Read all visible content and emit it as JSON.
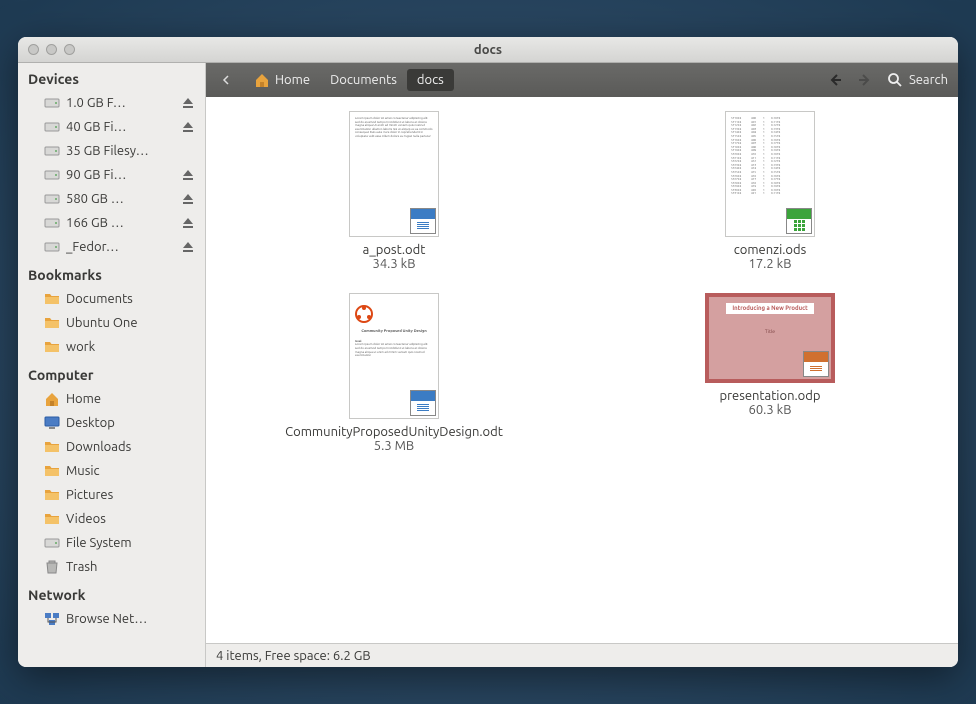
{
  "window": {
    "title": "docs"
  },
  "toolbar": {
    "crumbs": [
      "Home",
      "Documents",
      "docs"
    ],
    "search_label": "Search"
  },
  "sidebar": {
    "sections": [
      {
        "header": "Devices",
        "items": [
          {
            "label": "1.0 GB F…",
            "icon": "drive",
            "eject": true
          },
          {
            "label": "40 GB Fi…",
            "icon": "drive",
            "eject": true
          },
          {
            "label": "35 GB Filesy…",
            "icon": "drive",
            "eject": false
          },
          {
            "label": "90 GB Fi…",
            "icon": "drive",
            "eject": true
          },
          {
            "label": "580 GB …",
            "icon": "drive",
            "eject": true
          },
          {
            "label": "166 GB …",
            "icon": "drive",
            "eject": true
          },
          {
            "label": "_Fedor…",
            "icon": "drive",
            "eject": true
          }
        ]
      },
      {
        "header": "Bookmarks",
        "items": [
          {
            "label": "Documents",
            "icon": "folder",
            "eject": false
          },
          {
            "label": "Ubuntu One",
            "icon": "folder",
            "eject": false
          },
          {
            "label": "work",
            "icon": "folder",
            "eject": false
          }
        ]
      },
      {
        "header": "Computer",
        "items": [
          {
            "label": "Home",
            "icon": "home",
            "eject": false
          },
          {
            "label": "Desktop",
            "icon": "desktop",
            "eject": false
          },
          {
            "label": "Downloads",
            "icon": "folder",
            "eject": false
          },
          {
            "label": "Music",
            "icon": "folder",
            "eject": false
          },
          {
            "label": "Pictures",
            "icon": "folder",
            "eject": false
          },
          {
            "label": "Videos",
            "icon": "folder",
            "eject": false
          },
          {
            "label": "File System",
            "icon": "drive",
            "eject": false
          },
          {
            "label": "Trash",
            "icon": "trash",
            "eject": false
          }
        ]
      },
      {
        "header": "Network",
        "items": [
          {
            "label": "Browse Net…",
            "icon": "network",
            "eject": false
          }
        ]
      }
    ]
  },
  "files": [
    {
      "name": "a_post.odt",
      "size": "34.3 kB",
      "type": "text"
    },
    {
      "name": "comenzi.ods",
      "size": "17.2 kB",
      "type": "sheet"
    },
    {
      "name": "CommunityProposedUnityDesign.odt",
      "size": "5.3 MB",
      "type": "text-logo"
    },
    {
      "name": "presentation.odp",
      "size": "60.3 kB",
      "type": "pres"
    }
  ],
  "statusbar": "4 items, Free space: 6.2 GB",
  "pres_preview": {
    "title": "Introducing a New Product",
    "sub": "Title"
  }
}
